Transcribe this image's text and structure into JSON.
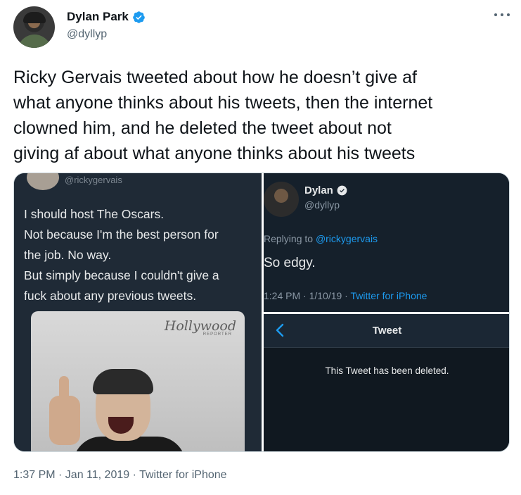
{
  "author": {
    "display_name": "Dylan Park",
    "handle": "@dyllyp",
    "verified_icon": "verified-badge-icon",
    "more_icon": "more-options-icon"
  },
  "tweet": {
    "text": "Ricky Gervais tweeted about how he doesn’t give af\nwhat anyone thinks about his tweets, then the internet\nclowned him, and he deleted the tweet about not\ngiving af about what anyone thinks about his tweets",
    "timestamp": "1:37 PM · Jan 11, 2019 · Twitter for iPhone"
  },
  "media": {
    "left": {
      "handle": "@rickygervais",
      "text": "I should host The Oscars.\nNot because I'm the best person for\nthe job. No way.\nBut simply because I couldn't give a\nfuck about any previous tweets.",
      "photo_logo": "Hollywood",
      "photo_logo_sub": "REPORTER"
    },
    "right_top": {
      "name": "Dylan",
      "handle": "@dyllyp",
      "replying_prefix": "Replying to ",
      "replying_handle": "@rickygervais",
      "text": "So edgy.",
      "meta_time": "1:24 PM · 1/10/19 · ",
      "meta_source": "Twitter for iPhone"
    },
    "right_bottom": {
      "title": "Tweet",
      "message": "This Tweet has been deleted."
    }
  },
  "colors": {
    "link_blue": "#1d9bf0",
    "dark_bg": "#15202b",
    "secondary_text": "#536471"
  }
}
